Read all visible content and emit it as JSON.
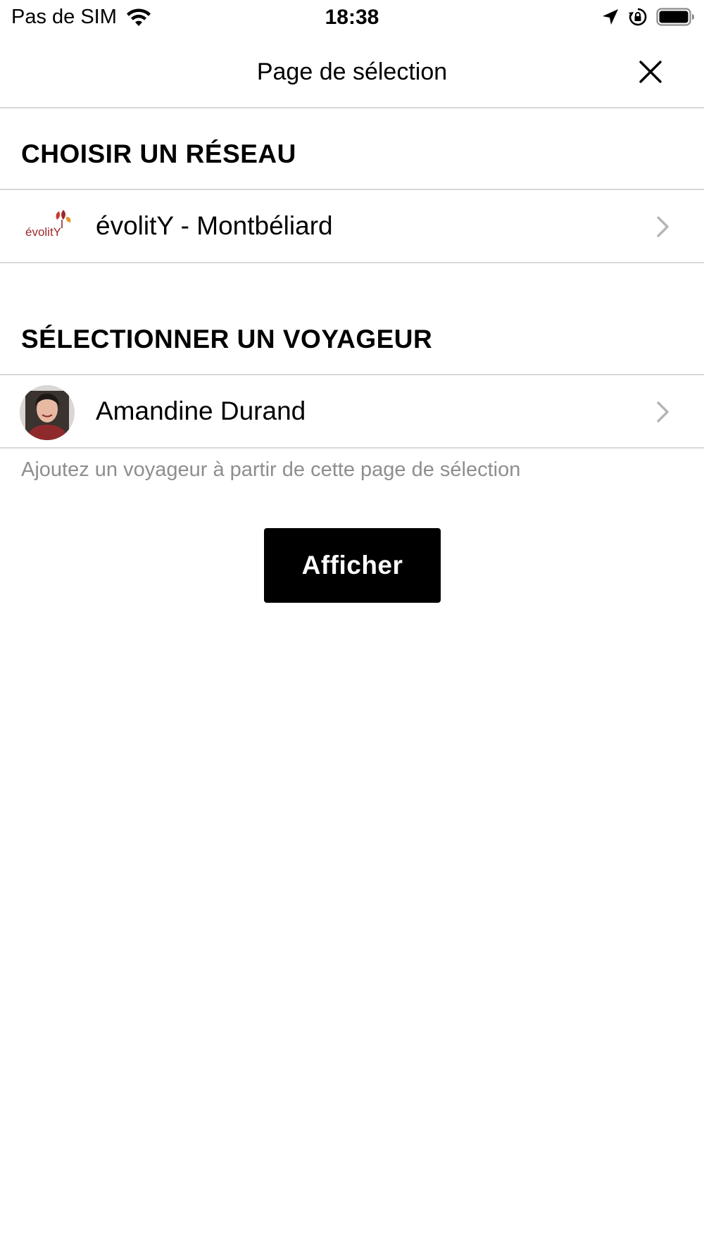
{
  "status_bar": {
    "carrier": "Pas de SIM",
    "time": "18:38"
  },
  "nav": {
    "title": "Page de sélection",
    "close_icon": "close-icon"
  },
  "network_section": {
    "header": "CHOISIR UN RÉSEAU",
    "selected_network": {
      "logo_text": "évolitY",
      "label": "évolitY - Montbéliard"
    }
  },
  "traveler_section": {
    "header": "SÉLECTIONNER UN VOYAGEUR",
    "selected_traveler": {
      "name": "Amandine Durand"
    },
    "hint": "Ajoutez un voyageur à partir de cette page de sélection"
  },
  "actions": {
    "show_label": "Afficher"
  },
  "colors": {
    "background": "#ffffff",
    "divider": "#d8d8d8",
    "hint_text": "#8e8e8e",
    "button_bg": "#000000",
    "button_text": "#ffffff",
    "logo_red": "#a0282c"
  }
}
